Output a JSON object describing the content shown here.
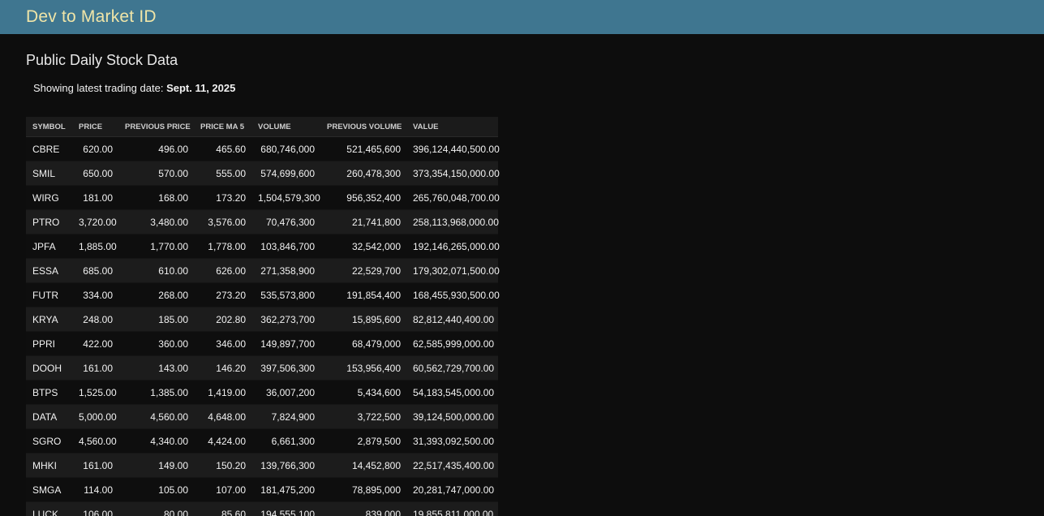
{
  "header": {
    "title": "Dev to Market ID"
  },
  "page": {
    "title": "Public Daily Stock Data",
    "date_label": "Showing latest trading date:",
    "date_value": "Sept. 11, 2025"
  },
  "table": {
    "columns": [
      "SYMBOL",
      "PRICE",
      "PREVIOUS PRICE",
      "PRICE MA 5",
      "VOLUME",
      "PREVIOUS VOLUME",
      "VALUE"
    ],
    "rows": [
      [
        "CBRE",
        "620.00",
        "496.00",
        "465.60",
        "680,746,000",
        "521,465,600",
        "396,124,440,500.00"
      ],
      [
        "SMIL",
        "650.00",
        "570.00",
        "555.00",
        "574,699,600",
        "260,478,300",
        "373,354,150,000.00"
      ],
      [
        "WIRG",
        "181.00",
        "168.00",
        "173.20",
        "1,504,579,300",
        "956,352,400",
        "265,760,048,700.00"
      ],
      [
        "PTRO",
        "3,720.00",
        "3,480.00",
        "3,576.00",
        "70,476,300",
        "21,741,800",
        "258,113,968,000.00"
      ],
      [
        "JPFA",
        "1,885.00",
        "1,770.00",
        "1,778.00",
        "103,846,700",
        "32,542,000",
        "192,146,265,000.00"
      ],
      [
        "ESSA",
        "685.00",
        "610.00",
        "626.00",
        "271,358,900",
        "22,529,700",
        "179,302,071,500.00"
      ],
      [
        "FUTR",
        "334.00",
        "268.00",
        "273.20",
        "535,573,800",
        "191,854,400",
        "168,455,930,500.00"
      ],
      [
        "KRYA",
        "248.00",
        "185.00",
        "202.80",
        "362,273,700",
        "15,895,600",
        "82,812,440,400.00"
      ],
      [
        "PPRI",
        "422.00",
        "360.00",
        "346.00",
        "149,897,700",
        "68,479,000",
        "62,585,999,000.00"
      ],
      [
        "DOOH",
        "161.00",
        "143.00",
        "146.20",
        "397,506,300",
        "153,956,400",
        "60,562,729,700.00"
      ],
      [
        "BTPS",
        "1,525.00",
        "1,385.00",
        "1,419.00",
        "36,007,200",
        "5,434,600",
        "54,183,545,000.00"
      ],
      [
        "DATA",
        "5,000.00",
        "4,560.00",
        "4,648.00",
        "7,824,900",
        "3,722,500",
        "39,124,500,000.00"
      ],
      [
        "SGRO",
        "4,560.00",
        "4,340.00",
        "4,424.00",
        "6,661,300",
        "2,879,500",
        "31,393,092,500.00"
      ],
      [
        "MHKI",
        "161.00",
        "149.00",
        "150.20",
        "139,766,300",
        "14,452,800",
        "22,517,435,400.00"
      ],
      [
        "SMGA",
        "114.00",
        "105.00",
        "107.00",
        "181,475,200",
        "78,895,000",
        "20,281,747,000.00"
      ],
      [
        "LUCK",
        "106.00",
        "80.00",
        "85.60",
        "194,555,100",
        "839,000",
        "19,855,811,000.00"
      ]
    ]
  }
}
